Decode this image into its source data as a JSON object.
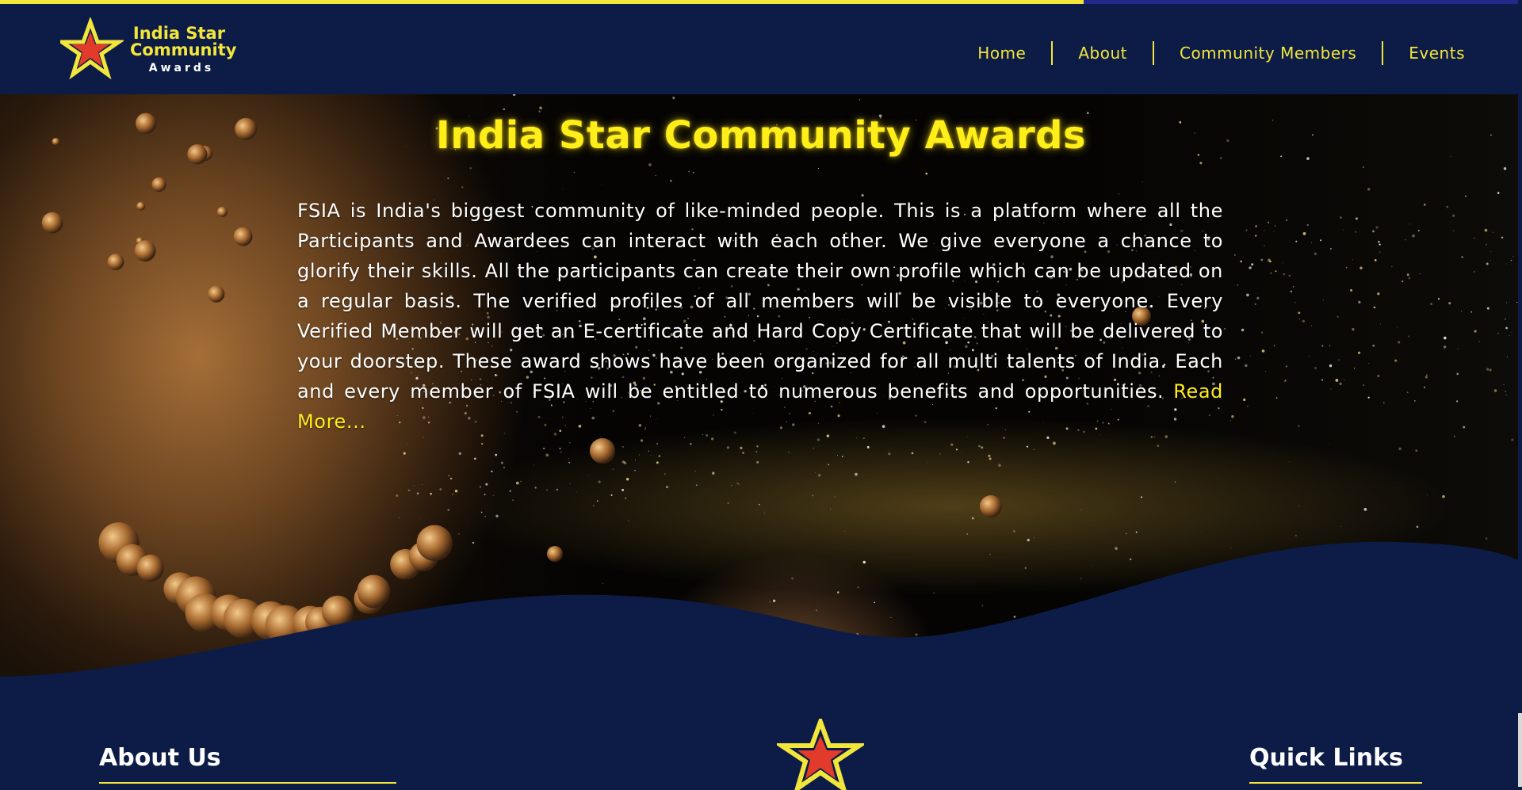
{
  "progress": {
    "fraction": 0.712,
    "fill_color": "#f2e63c",
    "track_color": "#1f2a8a"
  },
  "brand": {
    "line1": "India Star",
    "line2": "Community",
    "line3": "Awards",
    "icon": "star-logo-icon",
    "colors": {
      "star_outer": "#f2e63c",
      "star_inner": "#e23a2b",
      "navy": "#0d1c47"
    }
  },
  "nav": {
    "items": [
      {
        "label": "Home"
      },
      {
        "label": "About"
      },
      {
        "label": "Community Members"
      },
      {
        "label": "Events"
      }
    ]
  },
  "hero": {
    "title": "India Star Community Awards",
    "body": "FSIA is India's biggest community of like-minded people. This is a platform where all the Participants and Awardees can interact with each other. We give everyone a chance to glorify their skills. All the participants can create their own profile which can be updated on a regular basis. The verified profiles of all members will be visible to everyone. Every Verified Member will get an E-certificate and Hard Copy Certificate that will be delivered to your doorstep. These award shows have been organized for all multi talents of India. Each and every member of FSIA will be entitled to numerous benefits and opportunities.",
    "read_more": "Read More..."
  },
  "footer": {
    "about_heading": "About Us",
    "quick_links_heading": "Quick Links",
    "center_icon": "star-logo-icon"
  }
}
